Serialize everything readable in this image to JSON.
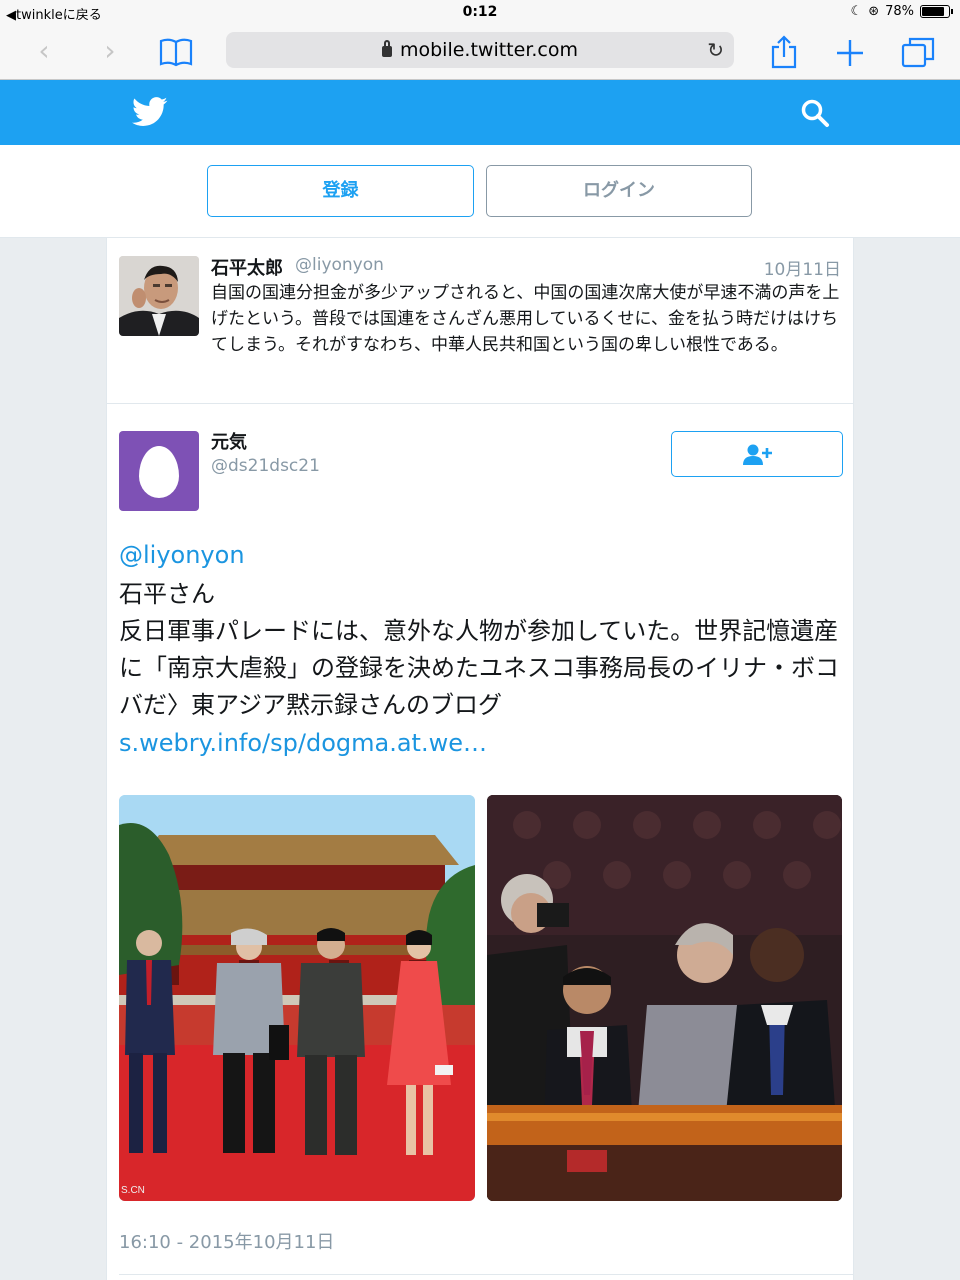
{
  "status_bar": {
    "back_label": "twinkleに戻る",
    "time": "0:12",
    "battery": "78%"
  },
  "browser": {
    "url": "mobile.twitter.com",
    "back_icon": "chevron-left-icon",
    "forward_icon": "chevron-right-icon",
    "bookmarks_icon": "book-icon",
    "share_icon": "share-icon",
    "new_tab_icon": "plus-icon",
    "tabs_icon": "tabs-icon"
  },
  "header": {
    "brand_color": "#1da1f2"
  },
  "auth": {
    "register_label": "登録",
    "login_label": "ログイン"
  },
  "tweet1": {
    "name": "石平太郎",
    "handle": "@liyonyon",
    "date": "10月11日",
    "text": "自国の国連分担金が多少アップされると、中国の国連次席大使が早速不満の声を上げたという。普段では国連をさんざん悪用しているくせに、金を払う時だけはけちてしまう。それがすなわち、中華人民共和国という国の卑しい根性である。"
  },
  "tweet2": {
    "name": "元気",
    "handle": "@ds21dsc21",
    "mention": "@liyonyon",
    "body_line1": "石平さん",
    "body_line2": "反日軍事パレードには、意外な人物が参加していた。世界記憶遺産に「南京大虐殺」の登録を決めたユネスコ事務局長のイリナ・ボコバだ〉東アジア黙示録さんのブログ",
    "link": "s.webry.info/sp/dogma.at.we…",
    "timestamp": "16:10 - 2015年10月11日",
    "photo1_watermark": "S.CN"
  }
}
